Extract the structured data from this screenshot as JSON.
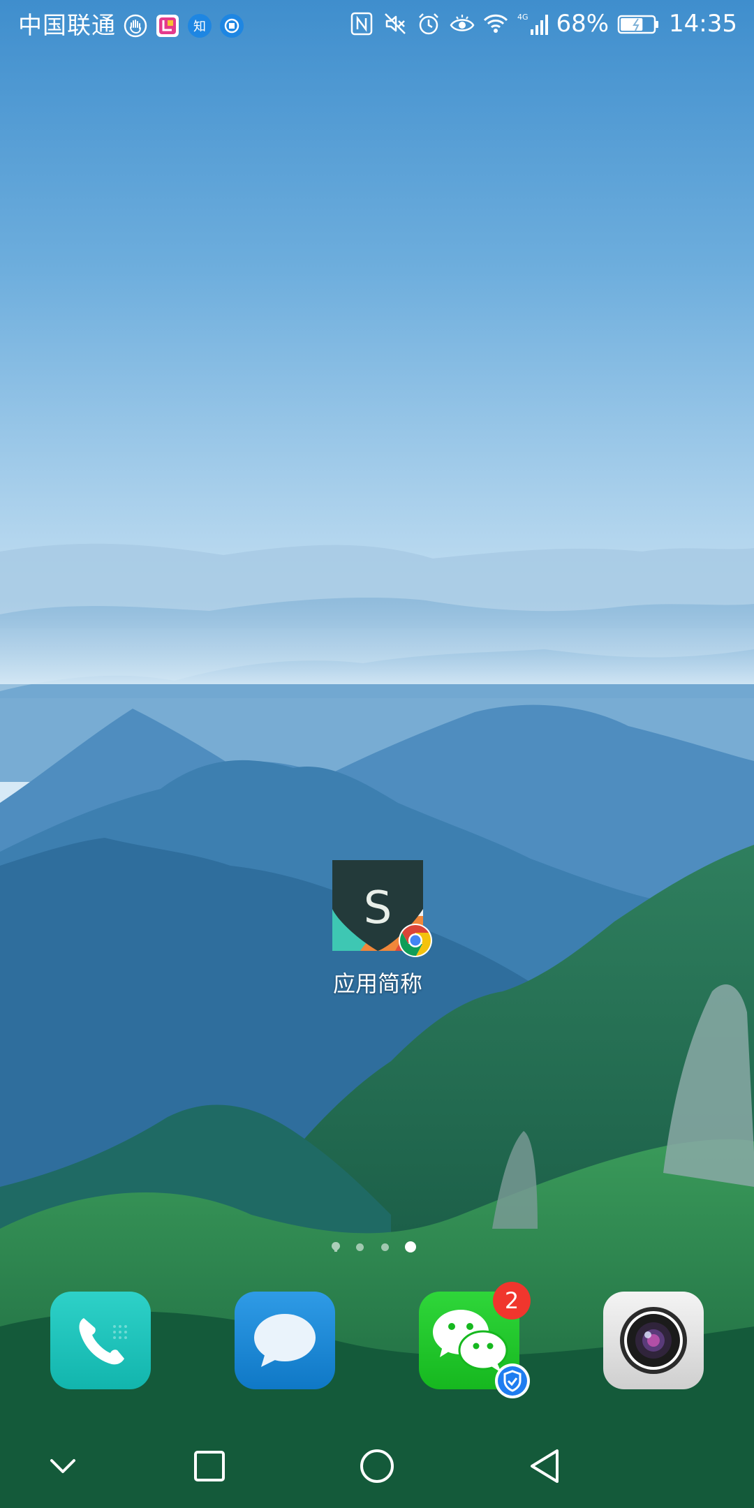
{
  "status_bar": {
    "carrier": "中国联通",
    "notification_icons": [
      "hand-stop-icon",
      "app-notification-icon",
      "zhihu-icon",
      "sync-icon"
    ],
    "zhihu_glyph": "知",
    "system_icons": [
      "nfc-icon",
      "mute-icon",
      "alarm-icon",
      "eye-comfort-icon",
      "wifi-icon",
      "signal-4g-icon"
    ],
    "network_type": "4G",
    "battery_percent": "68%",
    "battery_level": 0.68,
    "time": "14:35"
  },
  "home": {
    "shortcut": {
      "label": "应用简称",
      "letter": "S",
      "badge_icon": "chrome-icon"
    },
    "page_indicator": {
      "pages": 4,
      "current": 4
    }
  },
  "dock": {
    "apps": [
      {
        "name": "phone",
        "icon": "phone-icon",
        "color": "#1fc5c0"
      },
      {
        "name": "messages",
        "icon": "message-bubble-icon",
        "color": "#1c8bd8"
      },
      {
        "name": "wechat",
        "icon": "wechat-icon",
        "color": "#1fc42b",
        "badge": "2"
      },
      {
        "name": "camera",
        "icon": "camera-icon",
        "color": "#e6e6e6"
      }
    ]
  },
  "nav_bar": {
    "buttons": [
      "hide-nav-icon",
      "recents-icon",
      "home-icon",
      "back-icon"
    ]
  }
}
